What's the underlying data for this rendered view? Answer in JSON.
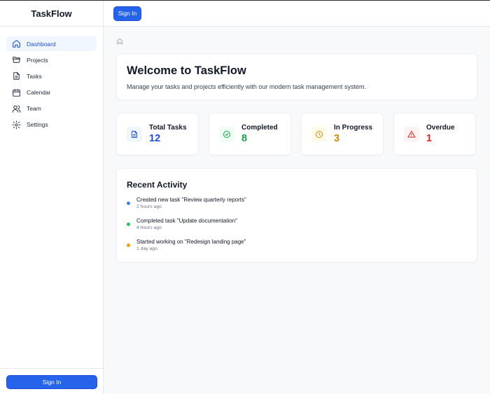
{
  "brand": "TaskFlow",
  "header": {
    "signin_label": "Sign In"
  },
  "sidebar": {
    "items": [
      {
        "label": "Dashboard",
        "icon": "home-icon",
        "active": true
      },
      {
        "label": "Projects",
        "icon": "folder-icon"
      },
      {
        "label": "Tasks",
        "icon": "file-icon"
      },
      {
        "label": "Calendar",
        "icon": "calendar-icon"
      },
      {
        "label": "Team",
        "icon": "users-icon"
      },
      {
        "label": "Settings",
        "icon": "gear-icon"
      }
    ],
    "signin_label": "Sign In"
  },
  "main": {
    "welcome": {
      "title": "Welcome to TaskFlow",
      "subtitle": "Manage your tasks and projects efficiently with our modern task management system."
    },
    "stats": [
      {
        "label": "Total Tasks",
        "value": "12",
        "icon": "document-icon",
        "color": "#1d4ed8",
        "bg": "#eff6ff"
      },
      {
        "label": "Completed",
        "value": "8",
        "icon": "check-circle-icon",
        "color": "#16a34a",
        "bg": "#f0fdf4"
      },
      {
        "label": "In Progress",
        "value": "3",
        "icon": "clock-icon",
        "color": "#ca8a04",
        "bg": "#fefce8"
      },
      {
        "label": "Overdue",
        "value": "1",
        "icon": "warning-icon",
        "color": "#dc2626",
        "bg": "#fef2f2"
      }
    ],
    "activity": {
      "title": "Recent Activity",
      "items": [
        {
          "text": "Created new task \"Review quarterly reports\"",
          "time": "2 hours ago",
          "color": "#3b82f6"
        },
        {
          "text": "Completed task \"Update documentation\"",
          "time": "4 hours ago",
          "color": "#22c55e"
        },
        {
          "text": "Started working on \"Redesign landing page\"",
          "time": "1 day ago",
          "color": "#f59e0b"
        }
      ]
    }
  }
}
